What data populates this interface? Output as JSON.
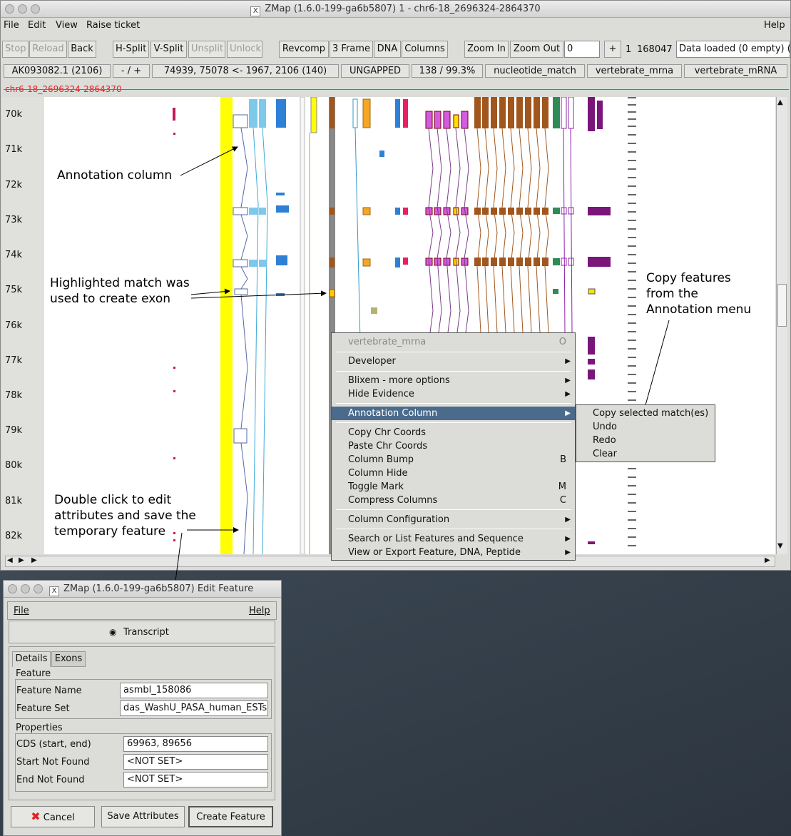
{
  "main_window": {
    "title": "ZMap (1.6.0-199-ga6b5807) 1 - chr6-18_2696324-2864370",
    "x_logo": "X",
    "menus": [
      "File",
      "Edit",
      "View",
      "Raise ticket",
      "Help"
    ],
    "toolbar": {
      "stop": "Stop",
      "reload": "Reload",
      "back": "Back",
      "hsplit": "H-Split",
      "vsplit": "V-Split",
      "unsplit": "Unsplit",
      "unlock": "Unlock",
      "revcomp": "Revcomp",
      "three_frame": "3 Frame",
      "dna": "DNA",
      "columns": "Columns",
      "zoom_in": "Zoom In",
      "zoom_out": "Zoom Out",
      "zoom_value": "0",
      "plus": "+",
      "range_start": "1",
      "range_end": "168047",
      "status": "Data loaded (0 empty) ("
    },
    "info_bar": [
      "AK093082.1  (2106)",
      "- / +",
      "74939, 75078  <-  1967, 2106  (140)",
      "UNGAPPED",
      "138 / 99.3%",
      "nucleotide_match",
      "vertebrate_mrna",
      "vertebrate_mRNA"
    ],
    "sequence_name": "chr6-18_2696324-2864370",
    "ruler_labels": [
      "70k",
      "71k",
      "72k",
      "73k",
      "74k",
      "75k",
      "76k",
      "77k",
      "78k",
      "79k",
      "80k",
      "81k",
      "82k"
    ]
  },
  "annotations": {
    "annotation_column": "Annotation column",
    "highlighted_1": "Highlighted match was",
    "highlighted_2": "used to create exon",
    "copy_1": "Copy features",
    "copy_2": "from the",
    "copy_3": "Annotation menu",
    "dbl_1": "Double click to edit",
    "dbl_2": "attributes and save the",
    "dbl_3": "temporary feature"
  },
  "context_menu": {
    "header": "vertebrate_mrna",
    "header_accel": "O",
    "developer": "Developer",
    "blixem": "Blixem - more options",
    "hide_evidence": "Hide Evidence",
    "annotation_column": "Annotation Column",
    "copy_chr": "Copy Chr Coords",
    "paste_chr": "Paste Chr Coords",
    "column_bump": "Column Bump",
    "column_bump_accel": "B",
    "column_hide": "Column Hide",
    "toggle_mark": "Toggle Mark",
    "toggle_mark_accel": "M",
    "compress": "Compress Columns",
    "compress_accel": "C",
    "column_config": "Column Configuration",
    "search": "Search or List Features and Sequence",
    "view_export": "View or Export Feature, DNA, Peptide"
  },
  "submenu": {
    "copy_selected": "Copy selected match(es)",
    "undo": "Undo",
    "redo": "Redo",
    "clear": "Clear"
  },
  "edit_window": {
    "title": "ZMap (1.6.0-199-ga6b5807) Edit Feature",
    "menu_file": "File",
    "menu_help": "Help",
    "radio": "Transcript",
    "tab_details": "Details",
    "tab_exons": "Exons",
    "group_feature": "Feature",
    "feature_name_label": "Feature Name",
    "feature_name_value": "asmbl_158086",
    "feature_set_label": "Feature Set",
    "feature_set_value": "das_WashU_PASA_human_ESTs",
    "group_properties": "Properties",
    "cds_label": "CDS (start, end)",
    "cds_value": "69963, 89656",
    "start_nf_label": "Start Not Found",
    "start_nf_value": "<NOT SET>",
    "end_nf_label": "End Not Found",
    "end_nf_value": "<NOT SET>",
    "cancel": "Cancel",
    "save": "Save Attributes",
    "create": "Create Feature"
  },
  "colors": {
    "highlight": "#ffff00",
    "selected_menu": "#4a6b8c",
    "seq_red": "#dd2222"
  }
}
